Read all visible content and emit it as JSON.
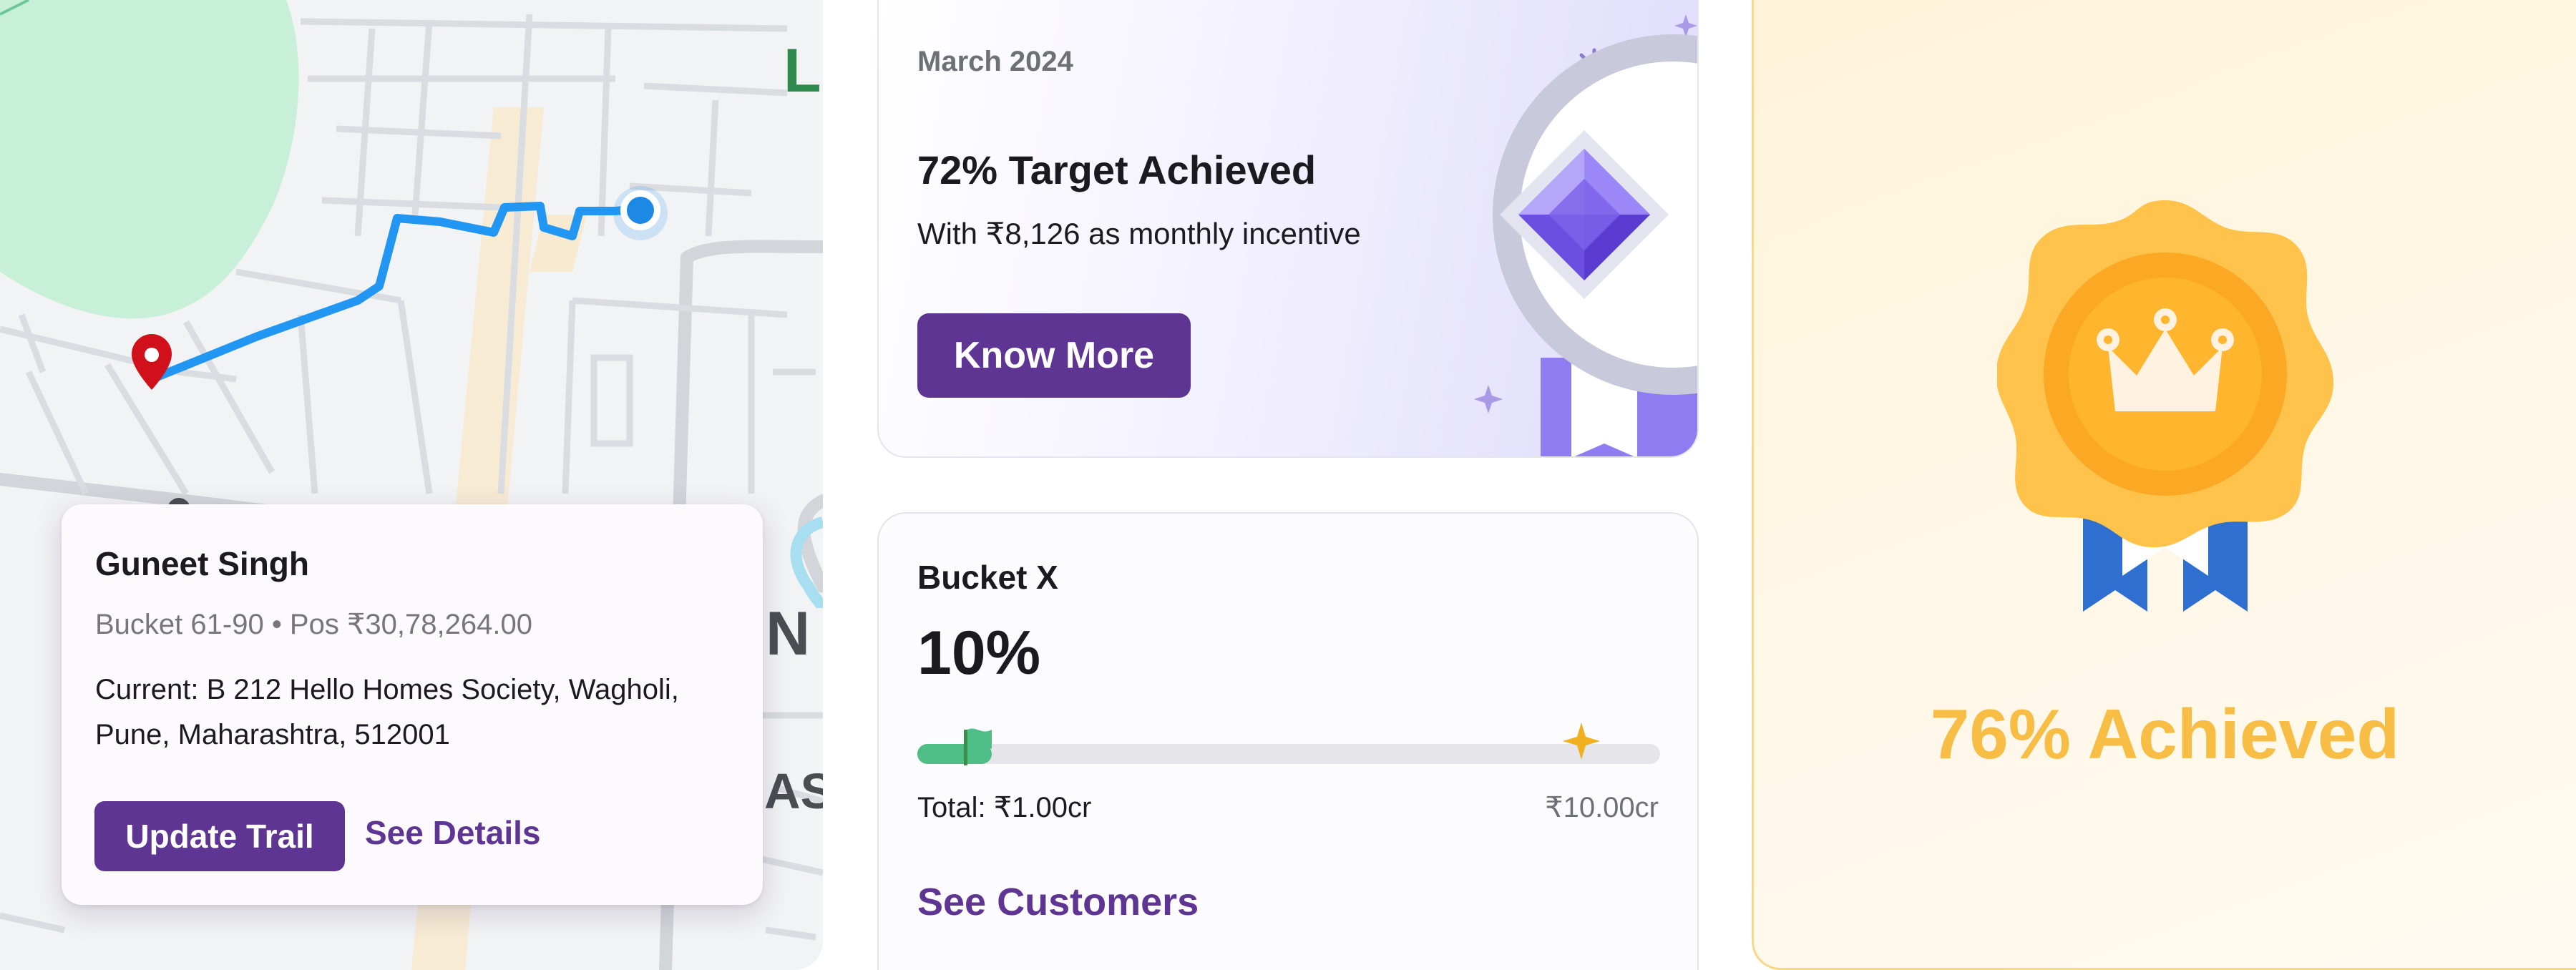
{
  "map_card": {
    "person_name": "Guneet Singh",
    "meta": "Bucket 61-90 • Pos ₹30,78,264.00",
    "address": "Current: B 212 Hello Homes Society, Wagholi, Pune, Maharashtra, 512001",
    "update_button": "Update Trail",
    "details_link": "See Details"
  },
  "map_labels": {
    "label_l": "L",
    "label_n": "N",
    "label_as": "AS"
  },
  "incentive": {
    "month": "March 2024",
    "title": "72% Target Achieved",
    "subtitle": "With ₹8,126 as monthly incentive",
    "button": "Know More"
  },
  "bucket": {
    "title": "Bucket X",
    "percent": "10%",
    "progress_fraction": 0.1,
    "total_label": "Total: ₹1.00cr",
    "max_label": "₹10.00cr",
    "link": "See Customers"
  },
  "achievement": {
    "text": "76% Achieved"
  },
  "colors": {
    "brand_purple": "#5e3593",
    "route_blue": "#2196f3",
    "progress_green": "#4fbe86",
    "gold": "#f8bd45"
  },
  "icons": [
    "location-pin-icon",
    "current-location-icon",
    "flag-icon",
    "sparkle-star-icon",
    "diamond-medal-icon",
    "crown-badge-icon"
  ]
}
